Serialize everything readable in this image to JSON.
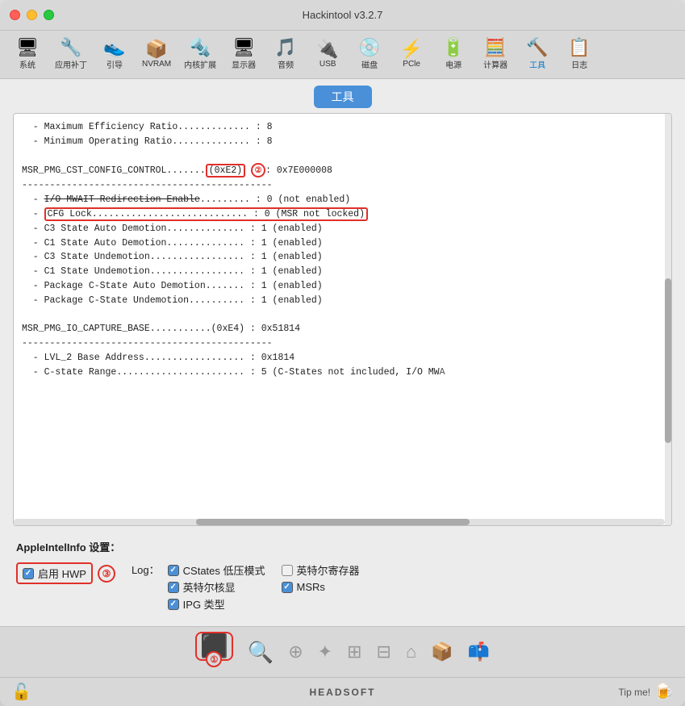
{
  "window": {
    "title": "Hackintool v3.2.7"
  },
  "toolbar": {
    "items": [
      {
        "id": "system",
        "label": "系统",
        "icon": "🖥"
      },
      {
        "id": "patch",
        "label": "应用补丁",
        "icon": "🔧"
      },
      {
        "id": "boot",
        "label": "引导",
        "icon": "👟"
      },
      {
        "id": "nvram",
        "label": "NVRAM",
        "icon": "📦"
      },
      {
        "id": "kext",
        "label": "内核扩展",
        "icon": "🔩"
      },
      {
        "id": "display",
        "label": "显示器",
        "icon": "🖥"
      },
      {
        "id": "audio",
        "label": "音频",
        "icon": "🎵"
      },
      {
        "id": "usb",
        "label": "USB",
        "icon": "🔌"
      },
      {
        "id": "disk",
        "label": "磁盘",
        "icon": "💿"
      },
      {
        "id": "pcie",
        "label": "PCle",
        "icon": "⚡"
      },
      {
        "id": "power",
        "label": "电源",
        "icon": "🔋"
      },
      {
        "id": "calc",
        "label": "计算器",
        "icon": "🧮"
      },
      {
        "id": "tools",
        "label": "工具",
        "icon": "🔨",
        "active": true
      },
      {
        "id": "log",
        "label": "日志",
        "icon": "📋"
      }
    ]
  },
  "tab": {
    "label": "工具"
  },
  "output": {
    "lines": [
      "  - Maximum Efficiency Ratio............. : 8",
      "  - Minimum Operating Ratio.............. : 8",
      "",
      "MSR_PMG_CST_CONFIG_CONTROL.......(0xE2) : 0x7E000008",
      "---------------------------------------------",
      "  - I/O MWAIT Redirection Enable......... : 0 (not enabled)",
      "  - CFG Lock............................ : 0 (MSR not locked)",
      "  - C3 State Auto Demotion.............. : 1 (enabled)",
      "  - C1 State Auto Demotion.............. : 1 (enabled)",
      "  - C3 State Undemotion................. : 1 (enabled)",
      "  - C1 State Undemotion................. : 1 (enabled)",
      "  - Package C-State Auto Demotion....... : 1 (enabled)",
      "  - Package C-State Undemotion.......... : 1 (enabled)",
      "",
      "MSR_PMG_IO_CAPTURE_BASE...........(0xE4) : 0x51814",
      "---------------------------------------------",
      "  - LVL_2 Base Address.................. : 0x1814",
      "  - C-state Range....................... : 5 (C-States not included, I/O MW"
    ]
  },
  "settings": {
    "title": "AppleIntelInfo 设置：",
    "hwp_label": "启用 HWP",
    "hwp_checked": true,
    "log_label": "Log：",
    "log_items": [
      {
        "label": "CStates 低压模式",
        "checked": true
      },
      {
        "label": "英特尔寄存器",
        "checked": false
      },
      {
        "label": "英特尔核显",
        "checked": true
      },
      {
        "label": "MSRs",
        "checked": true
      },
      {
        "label": "IPG 类型",
        "checked": true
      }
    ]
  },
  "bottom_icons": [
    {
      "id": "cpu",
      "icon": "▣",
      "active": true,
      "highlight": true
    },
    {
      "id": "search",
      "icon": "🔍",
      "active": false
    },
    {
      "id": "tune",
      "icon": "⚙",
      "active": false
    },
    {
      "id": "bluetooth",
      "icon": "✦",
      "active": false
    },
    {
      "id": "grid1",
      "icon": "⊞",
      "active": false
    },
    {
      "id": "grid2",
      "icon": "⊞",
      "active": false
    },
    {
      "id": "home",
      "icon": "⌂",
      "active": false
    },
    {
      "id": "package",
      "icon": "📦",
      "active": false
    },
    {
      "id": "package2",
      "icon": "📦",
      "active": false
    }
  ],
  "badges": {
    "circle1": "①",
    "circle2": "②",
    "circle3": "③"
  },
  "footer": {
    "brand": "HEADSOFT",
    "tip_label": "Tip me!",
    "lock_icon": "🔓",
    "beer_icon": "🍺"
  }
}
